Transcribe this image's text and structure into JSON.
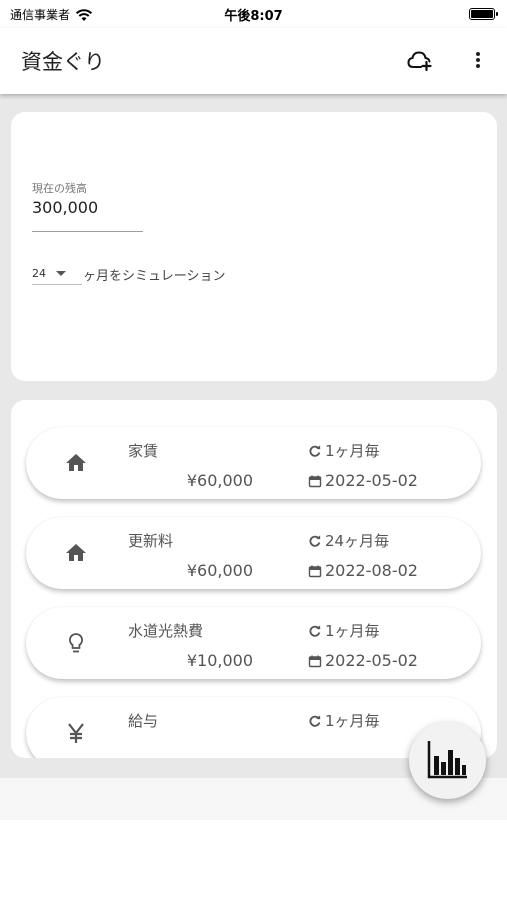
{
  "status_bar": {
    "carrier": "通信事業者",
    "time": "午後8:07"
  },
  "app_bar": {
    "title": "資金ぐり",
    "icons": [
      "cloud-add-icon",
      "more-vert-icon"
    ]
  },
  "settings": {
    "balance_label": "現在の残高",
    "balance_value": "300,000",
    "months_value": "24",
    "months_suffix": "ヶ月をシミュレーション"
  },
  "items": [
    {
      "icon": "home-icon",
      "name": "家賃",
      "amount": "¥60,000",
      "frequency": "1ヶ月毎",
      "date": "2022-05-02"
    },
    {
      "icon": "home-icon",
      "name": "更新料",
      "amount": "¥60,000",
      "frequency": "24ヶ月毎",
      "date": "2022-08-02"
    },
    {
      "icon": "lightbulb-icon",
      "name": "水道光熱費",
      "amount": "¥10,000",
      "frequency": "1ヶ月毎",
      "date": "2022-05-02"
    },
    {
      "icon": "yen-icon",
      "name": "給与",
      "amount": "",
      "frequency": "1ヶ月毎",
      "date": ""
    }
  ],
  "fab": {
    "icon": "bar-chart-icon"
  },
  "colors": {
    "background": "#e8e8e8",
    "card": "#ffffff",
    "text": "#555555",
    "fab": "#f2f2f2"
  }
}
